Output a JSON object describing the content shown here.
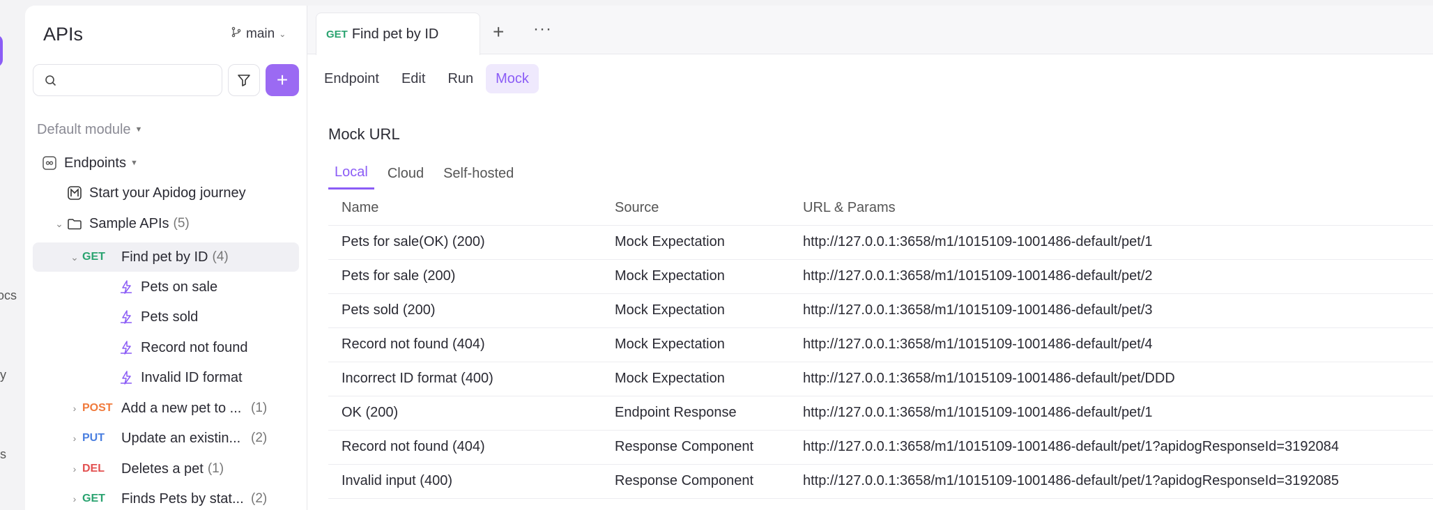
{
  "rail": {
    "labels": [
      "ocs",
      "y",
      "s"
    ]
  },
  "sidebar": {
    "title": "APIs",
    "branch": "main",
    "search_placeholder": "",
    "module": "Default module",
    "endpoints_label": "Endpoints",
    "journey": "Start your Apidog journey",
    "sample_folder": {
      "label": "Sample APIs",
      "count": "(5)"
    },
    "selected": {
      "method": "GET",
      "label": "Find pet by ID",
      "count": "(4)"
    },
    "expectations": [
      "Pets on sale",
      "Pets sold",
      "Record not found",
      "Invalid ID format"
    ],
    "endpoints": [
      {
        "method": "POST",
        "label": "Add a new pet to ...",
        "count": "(1)"
      },
      {
        "method": "PUT",
        "label": "Update an existin...",
        "count": "(2)"
      },
      {
        "method": "DEL",
        "label": "Deletes a pet",
        "count": "(1)"
      },
      {
        "method": "GET",
        "label": "Finds Pets by stat...",
        "count": "(2)"
      }
    ]
  },
  "tabbar": {
    "active_tab": {
      "method": "GET",
      "label": "Find pet by ID"
    },
    "plus": "+",
    "more": "···"
  },
  "subtabs": [
    "Endpoint",
    "Edit",
    "Run",
    "Mock"
  ],
  "mock": {
    "title": "Mock URL",
    "tabs": [
      "Local",
      "Cloud",
      "Self-hosted"
    ],
    "columns": [
      "Name",
      "Source",
      "URL & Params"
    ],
    "rows": [
      [
        "Pets for sale(OK) (200)",
        "Mock Expectation",
        "http://127.0.0.1:3658/m1/1015109-1001486-default/pet/1"
      ],
      [
        "Pets for sale (200)",
        "Mock Expectation",
        "http://127.0.0.1:3658/m1/1015109-1001486-default/pet/2"
      ],
      [
        "Pets sold (200)",
        "Mock Expectation",
        "http://127.0.0.1:3658/m1/1015109-1001486-default/pet/3"
      ],
      [
        "Record not found (404)",
        "Mock Expectation",
        "http://127.0.0.1:3658/m1/1015109-1001486-default/pet/4"
      ],
      [
        "Incorrect ID format (400)",
        "Mock Expectation",
        "http://127.0.0.1:3658/m1/1015109-1001486-default/pet/DDD"
      ],
      [
        "OK (200)",
        "Endpoint Response",
        "http://127.0.0.1:3658/m1/1015109-1001486-default/pet/1"
      ],
      [
        "Record not found (404)",
        "Response Component",
        "http://127.0.0.1:3658/m1/1015109-1001486-default/pet/1?apidogResponseId=3192084"
      ],
      [
        "Invalid input (400)",
        "Response Component",
        "http://127.0.0.1:3658/m1/1015109-1001486-default/pet/1?apidogResponseId=3192085"
      ]
    ]
  },
  "colors": {
    "accent": "#8b5cf6",
    "get": "#2aa370",
    "post": "#f07a3c",
    "put": "#4a7fe0",
    "del": "#e25050"
  }
}
